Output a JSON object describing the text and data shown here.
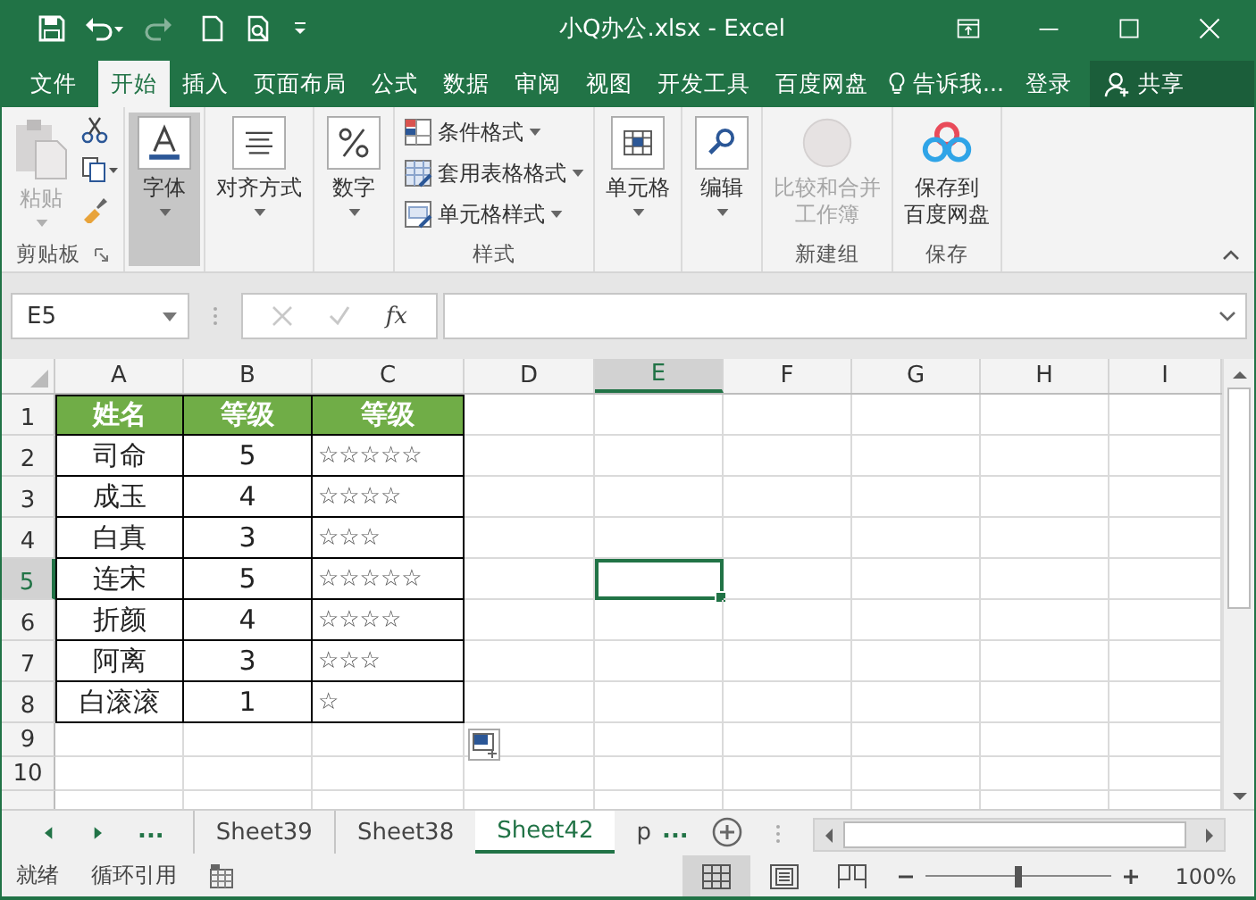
{
  "title_bar": {
    "title": "小Q办公.xlsx - Excel"
  },
  "ribbon_tabs": [
    {
      "label": "文件",
      "selected": false
    },
    {
      "label": "开始",
      "selected": true
    },
    {
      "label": "插入",
      "selected": false
    },
    {
      "label": "页面布局",
      "selected": false
    },
    {
      "label": "公式",
      "selected": false
    },
    {
      "label": "数据",
      "selected": false
    },
    {
      "label": "审阅",
      "selected": false
    },
    {
      "label": "视图",
      "selected": false
    },
    {
      "label": "开发工具",
      "selected": false
    },
    {
      "label": "百度网盘",
      "selected": false
    }
  ],
  "tell_me": "告诉我...",
  "sign_in": "登录",
  "share": "共享",
  "ribbon_groups": [
    {
      "kind": "clipboard",
      "label": "剪贴板",
      "buttons": [
        {
          "label": "粘贴",
          "disabled": true,
          "pressed": false
        }
      ]
    },
    {
      "kind": "font",
      "buttons": [
        {
          "label": "字体",
          "disabled": false,
          "pressed": true
        }
      ]
    },
    {
      "kind": "alignment",
      "buttons": [
        {
          "label": "对齐方式",
          "disabled": false,
          "pressed": false
        }
      ]
    },
    {
      "kind": "number",
      "buttons": [
        {
          "label": "数字",
          "disabled": false,
          "pressed": false
        }
      ]
    },
    {
      "kind": "styles",
      "label": "样式",
      "buttons": [
        {
          "label": "条件格式",
          "disabled": false,
          "pressed": false
        },
        {
          "label": "套用表格格式",
          "disabled": false,
          "pressed": false
        },
        {
          "label": "单元格样式",
          "disabled": false,
          "pressed": false
        }
      ]
    },
    {
      "kind": "cells",
      "buttons": [
        {
          "label": "单元格",
          "disabled": false,
          "pressed": false
        }
      ]
    },
    {
      "kind": "editing",
      "buttons": [
        {
          "label": "编辑",
          "disabled": false,
          "pressed": false
        }
      ]
    },
    {
      "kind": "compare",
      "label": "新建组",
      "buttons": [
        {
          "lines": [
            "比较和合并",
            "工作簿"
          ],
          "disabled": true,
          "pressed": false
        }
      ]
    },
    {
      "kind": "baidu",
      "label": "保存",
      "buttons": [
        {
          "lines": [
            "保存到",
            "百度网盘"
          ],
          "disabled": false,
          "pressed": false
        }
      ]
    }
  ],
  "formula_bar": {
    "name_box": "E5",
    "function_label": "fx"
  },
  "grid": {
    "columns": [
      {
        "label": "A",
        "selected": false
      },
      {
        "label": "B",
        "selected": false
      },
      {
        "label": "C",
        "selected": false
      },
      {
        "label": "D",
        "selected": false
      },
      {
        "label": "E",
        "selected": true
      },
      {
        "label": "F",
        "selected": false
      },
      {
        "label": "G",
        "selected": false
      },
      {
        "label": "H",
        "selected": false
      },
      {
        "label": "I",
        "selected": false
      }
    ],
    "rows": [
      {
        "label": "1",
        "kind": "header",
        "selected": false,
        "cells": [
          "姓名",
          "等级",
          "等级"
        ]
      },
      {
        "label": "2",
        "kind": "data",
        "selected": false,
        "cells": [
          "司命",
          "5",
          "☆☆☆☆☆"
        ]
      },
      {
        "label": "3",
        "kind": "data",
        "selected": false,
        "cells": [
          "成玉",
          "4",
          "☆☆☆☆"
        ]
      },
      {
        "label": "4",
        "kind": "data",
        "selected": false,
        "cells": [
          "白真",
          "3",
          "☆☆☆"
        ]
      },
      {
        "label": "5",
        "kind": "data",
        "selected": true,
        "cells": [
          "连宋",
          "5",
          "☆☆☆☆☆"
        ]
      },
      {
        "label": "6",
        "kind": "data",
        "selected": false,
        "cells": [
          "折颜",
          "4",
          "☆☆☆☆"
        ]
      },
      {
        "label": "7",
        "kind": "data",
        "selected": false,
        "cells": [
          "阿离",
          "3",
          "☆☆☆"
        ]
      },
      {
        "label": "8",
        "kind": "data",
        "selected": false,
        "cells": [
          "白滚滚",
          "1",
          "☆"
        ]
      },
      {
        "label": "9",
        "kind": "empty",
        "selected": false
      },
      {
        "label": "10",
        "kind": "empty",
        "selected": false
      }
    ]
  },
  "sheet_tabs": [
    {
      "label": "Sheet39",
      "selected": false
    },
    {
      "label": "Sheet38",
      "selected": false
    },
    {
      "label": "Sheet42",
      "selected": true
    },
    {
      "label": "p",
      "selected": false
    }
  ],
  "tab_ellipsis": [
    "...",
    "..."
  ],
  "status_bar": {
    "ready": "就绪",
    "circular_reference": "循环引用",
    "views": [
      {
        "selected": true
      },
      {
        "selected": false
      },
      {
        "selected": false
      }
    ],
    "zoom": {
      "level": 0.5,
      "label": "100%"
    }
  }
}
